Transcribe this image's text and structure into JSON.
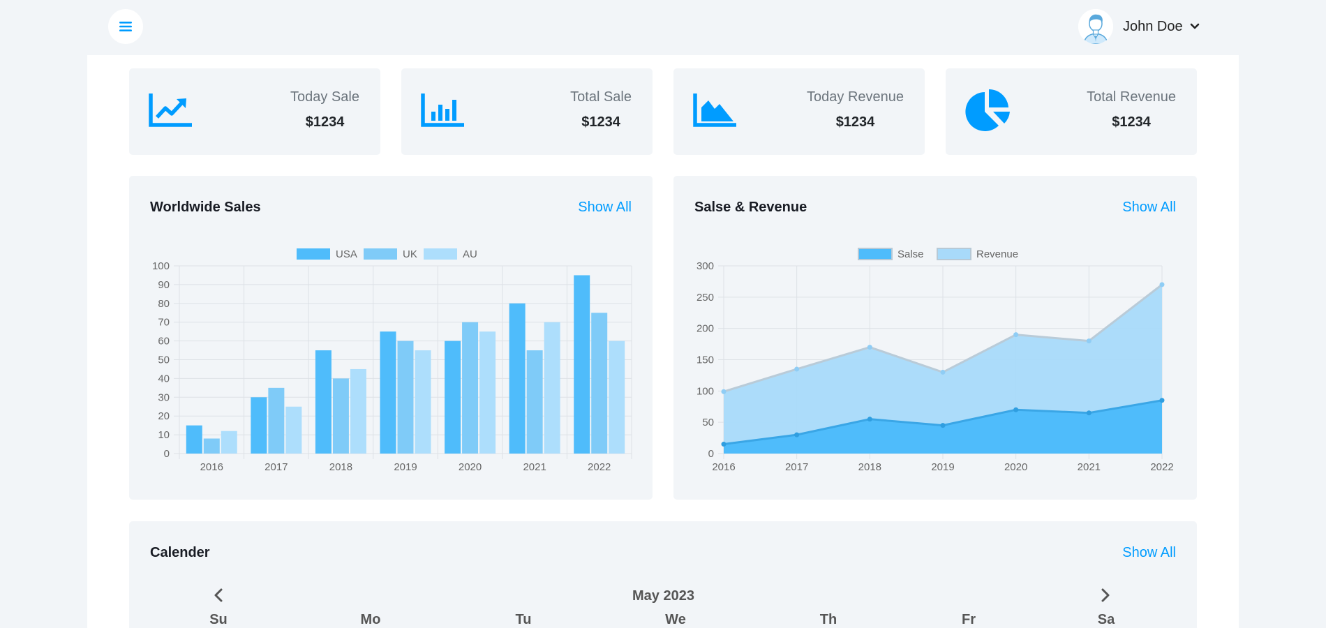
{
  "user": {
    "name": "John Doe"
  },
  "stats": [
    {
      "label": "Today Sale",
      "value": "$1234",
      "icon": "chart-line-icon"
    },
    {
      "label": "Total Sale",
      "value": "$1234",
      "icon": "chart-bar-icon"
    },
    {
      "label": "Today Revenue",
      "value": "$1234",
      "icon": "chart-area-icon"
    },
    {
      "label": "Total Revenue",
      "value": "$1234",
      "icon": "chart-pie-icon"
    }
  ],
  "worldwide": {
    "title": "Worldwide Sales",
    "show_all": "Show All"
  },
  "revenue": {
    "title": "Salse & Revenue",
    "show_all": "Show All"
  },
  "calendar": {
    "title": "Calender",
    "show_all": "Show All",
    "month": "May 2023",
    "weekdays": [
      "Su",
      "Mo",
      "Tu",
      "We",
      "Th",
      "Fr",
      "Sa"
    ]
  },
  "colors": {
    "accent": "#009cff",
    "usa": "#4fbcfb",
    "uk": "#7fcbf8",
    "au": "#addefc",
    "salse": "#4fbcfb",
    "revenue": "#a8dafa"
  },
  "chart_data": [
    {
      "type": "bar",
      "title": "Worldwide Sales",
      "categories": [
        "2016",
        "2017",
        "2018",
        "2019",
        "2020",
        "2021",
        "2022"
      ],
      "series": [
        {
          "name": "USA",
          "values": [
            15,
            30,
            55,
            65,
            60,
            80,
            95
          ]
        },
        {
          "name": "UK",
          "values": [
            8,
            35,
            40,
            60,
            70,
            55,
            75
          ]
        },
        {
          "name": "AU",
          "values": [
            12,
            25,
            45,
            55,
            65,
            70,
            60
          ]
        }
      ],
      "ylim": [
        0,
        100
      ],
      "yticks": [
        0,
        10,
        20,
        30,
        40,
        50,
        60,
        70,
        80,
        90,
        100
      ],
      "grid": true,
      "legend": "top-center"
    },
    {
      "type": "area",
      "title": "Salse & Revenue",
      "x": [
        "2016",
        "2017",
        "2018",
        "2019",
        "2020",
        "2021",
        "2022"
      ],
      "series": [
        {
          "name": "Salse",
          "values": [
            15,
            30,
            55,
            45,
            70,
            65,
            85
          ]
        },
        {
          "name": "Revenue",
          "values": [
            99,
            135,
            170,
            130,
            190,
            180,
            270
          ]
        }
      ],
      "ylim": [
        0,
        300
      ],
      "yticks": [
        0,
        50,
        100,
        150,
        200,
        250,
        300
      ],
      "grid": true,
      "legend": "top-center"
    }
  ]
}
